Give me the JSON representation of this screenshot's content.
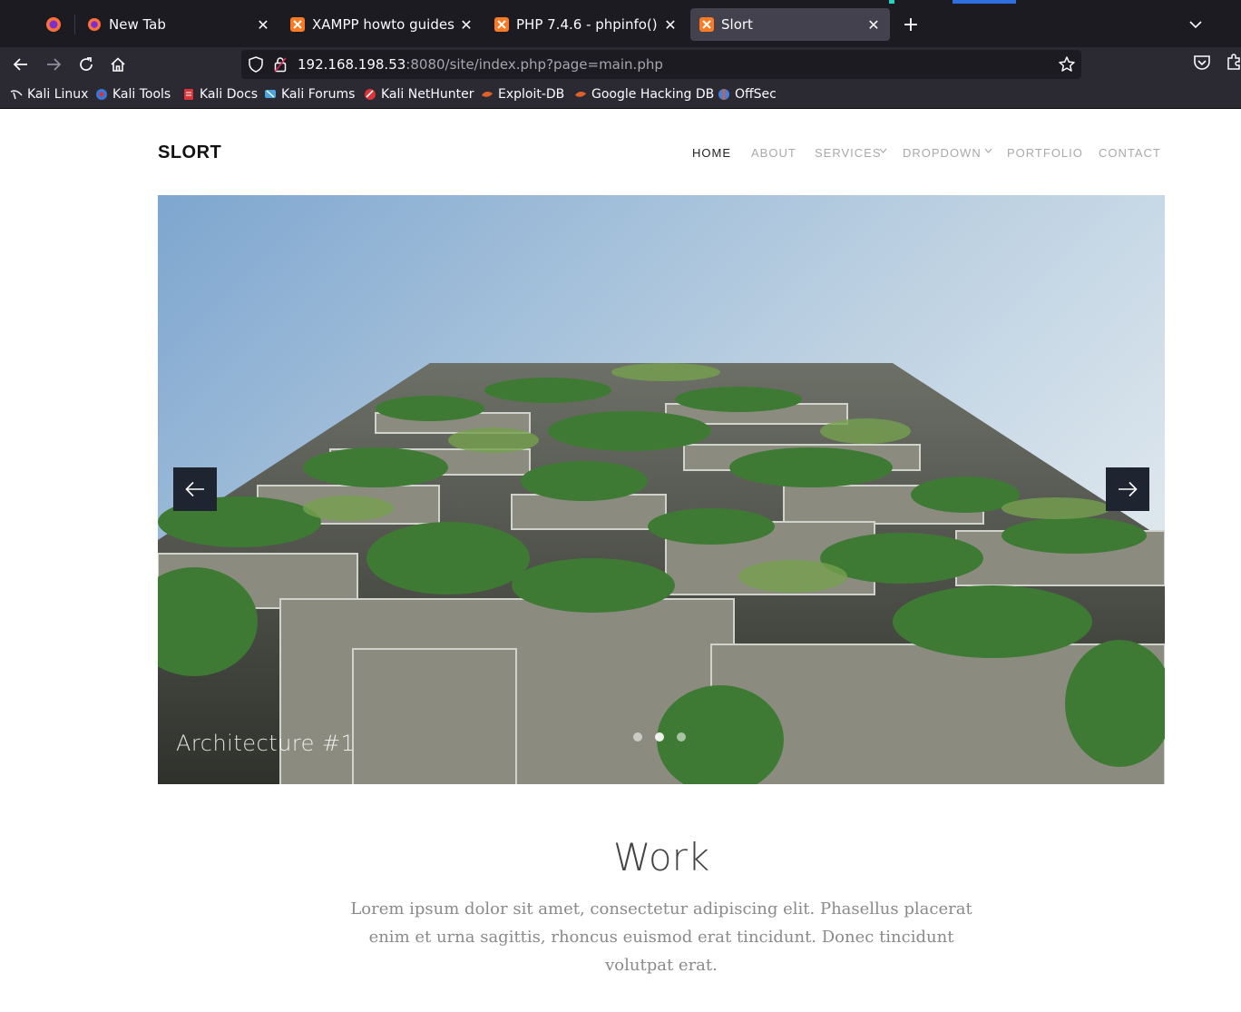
{
  "browser": {
    "tabs": [
      {
        "title": "New Tab",
        "icon": "firefox-icon",
        "active": false
      },
      {
        "title": "XAMPP howto guides",
        "icon": "xampp-icon",
        "active": false
      },
      {
        "title": "PHP 7.4.6 - phpinfo()",
        "icon": "xampp-icon",
        "active": false
      },
      {
        "title": "Slort",
        "icon": "xampp-icon",
        "active": true
      }
    ],
    "url": {
      "host": "192.168.198.53",
      "rest": ":8080/site/index.php?page=main.php"
    },
    "bookmarks": [
      {
        "label": "Kali Linux",
        "icon": "kali-dragon-icon",
        "color": "#e6e6e6"
      },
      {
        "label": "Kali Tools",
        "icon": "kali-tools-icon",
        "color": "#3a78d8"
      },
      {
        "label": "Kali Docs",
        "icon": "kali-docs-icon",
        "color": "#d9343a"
      },
      {
        "label": "Kali Forums",
        "icon": "kali-forums-icon",
        "color": "#4aa3df"
      },
      {
        "label": "Kali NetHunter",
        "icon": "nethunter-icon",
        "color": "#d9343a"
      },
      {
        "label": "Exploit-DB",
        "icon": "exploit-db-icon",
        "color": "#e0602b"
      },
      {
        "label": "Google Hacking DB",
        "icon": "ghdb-icon",
        "color": "#e0602b"
      },
      {
        "label": "OffSec",
        "icon": "offsec-icon",
        "color": "#4a7fd8"
      }
    ]
  },
  "site": {
    "logo": "SLORT",
    "nav": [
      {
        "label": "HOME",
        "active": true,
        "dropdown": false
      },
      {
        "label": "ABOUT",
        "active": false,
        "dropdown": false
      },
      {
        "label": "SERVICES",
        "active": false,
        "dropdown": true
      },
      {
        "label": "DROPDOWN",
        "active": false,
        "dropdown": true
      },
      {
        "label": "PORTFOLIO",
        "active": false,
        "dropdown": false
      },
      {
        "label": "CONTACT",
        "active": false,
        "dropdown": false
      }
    ],
    "hero": {
      "caption": "Architecture #1",
      "slide_count": 3,
      "active_slide": 2,
      "image": "vertical-forest-building-photo"
    },
    "section": {
      "title": "Work",
      "text": "Lorem ipsum dolor sit amet, consectetur adipiscing elit. Phasellus placerat enim et urna sagittis, rhoncus euismod erat tincidunt. Donec tincidunt volutpat erat."
    }
  }
}
